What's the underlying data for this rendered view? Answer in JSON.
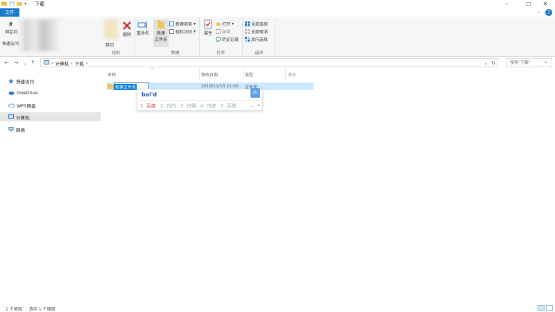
{
  "window": {
    "title": "下载",
    "minimize": "–",
    "maximize": "□",
    "close": "✕"
  },
  "ribbon_tabs": {
    "file": "文件",
    "help": "?"
  },
  "ribbon": {
    "pin": "固定到",
    "quick_access": "快速访问",
    "cut_label": "剪切",
    "organize": "组织",
    "delete": "删除",
    "rename": "重命名",
    "new_folder": "新建\n文件夹",
    "new_item": "新建项目",
    "easy_access": "轻松访问",
    "new_group": "新建",
    "properties": "属性",
    "open": "打开",
    "edit": "编辑",
    "history": "历史记录",
    "open_group": "打开",
    "select_all": "全部选择",
    "select_none": "全部取消",
    "invert_selection": "反向选择",
    "select_group": "选择"
  },
  "address": {
    "crumbs": [
      "计算机",
      "下载"
    ],
    "search_placeholder": "搜索\"下载\""
  },
  "nav": {
    "items": [
      {
        "label": "快速访问",
        "icon": "star-icon"
      },
      {
        "label": "OneDrive",
        "icon": "cloud-icon"
      },
      {
        "label": "WPS网盘",
        "icon": "cloud-outline-icon"
      },
      {
        "label": "计算机",
        "icon": "computer-icon"
      },
      {
        "label": "网络",
        "icon": "network-icon"
      }
    ]
  },
  "columns": {
    "name": "名称",
    "modified": "修改日期",
    "type": "类型",
    "size": "大小"
  },
  "files": [
    {
      "name": "新建文件夹",
      "modified": "2018/11/15 21:02",
      "type": "文件夹"
    }
  ],
  "ime": {
    "input": "bai'd",
    "logo": "du",
    "candidates": [
      "1. 百度",
      "2. 白的",
      "3. 白得",
      "4. 白底",
      "5. 百搭"
    ],
    "more": "…",
    "next": ">"
  },
  "status": {
    "count": "1 个项目",
    "selected": "选中 1 个项目"
  },
  "colors": {
    "accent": "#1979ca",
    "selection": "#cce8ff"
  }
}
